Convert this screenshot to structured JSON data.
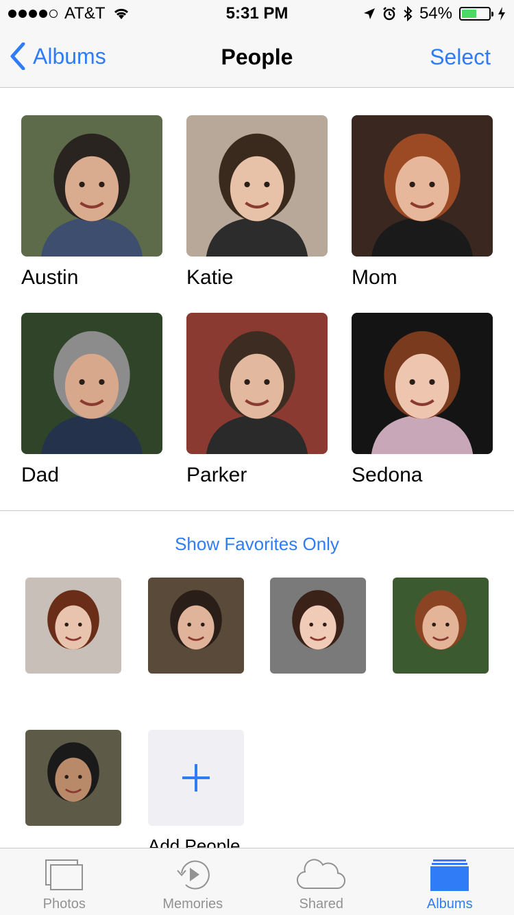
{
  "status": {
    "carrier": "AT&T",
    "time": "5:31 PM",
    "battery": "54%",
    "battery_level": 0.54
  },
  "nav": {
    "back_label": "Albums",
    "title": "People",
    "select_label": "Select"
  },
  "people": [
    {
      "name": "Austin",
      "skin": "#d9ab8f",
      "hair": "#2a2420",
      "bg": "#5d6b4a",
      "shirt": "#3d4e6e"
    },
    {
      "name": "Katie",
      "skin": "#e8c2a8",
      "hair": "#3a2a1e",
      "bg": "#b8a89a",
      "shirt": "#2c2c2c"
    },
    {
      "name": "Mom",
      "skin": "#e6b79a",
      "hair": "#9c4a24",
      "bg": "#3a2820",
      "shirt": "#1a1a1a"
    },
    {
      "name": "Dad",
      "skin": "#d8a88c",
      "hair": "#8c8c8c",
      "bg": "#2f4428",
      "shirt": "#25324c"
    },
    {
      "name": "Parker",
      "skin": "#e2b89e",
      "hair": "#3c2c22",
      "bg": "#8a3a30",
      "shirt": "#2a2a2a"
    },
    {
      "name": "Sedona",
      "skin": "#eec6b0",
      "hair": "#7a3a1e",
      "bg": "#141414",
      "shirt": "#c8a8b8"
    }
  ],
  "favorites_link": "Show Favorites Only",
  "others": [
    {
      "skin": "#e8c4ae",
      "hair": "#6a2e18",
      "bg": "#c8c0b8"
    },
    {
      "skin": "#e0b49a",
      "hair": "#2a1e18",
      "bg": "#5a4a3a"
    },
    {
      "skin": "#f0ccb8",
      "hair": "#3a2218",
      "bg": "#7a7a7a"
    },
    {
      "skin": "#e4b498",
      "hair": "#8a4424",
      "bg": "#3c5a30"
    },
    {
      "skin": "#b88a6a",
      "hair": "#1a1a1a",
      "bg": "#5e5a48"
    }
  ],
  "add_people_label": "Add People",
  "tabs": [
    {
      "label": "Photos",
      "active": false
    },
    {
      "label": "Memories",
      "active": false
    },
    {
      "label": "Shared",
      "active": false
    },
    {
      "label": "Albums",
      "active": true
    }
  ],
  "colors": {
    "accent": "#2f7cf6",
    "inactive": "#929292",
    "bar_bg": "#f7f7f7"
  }
}
